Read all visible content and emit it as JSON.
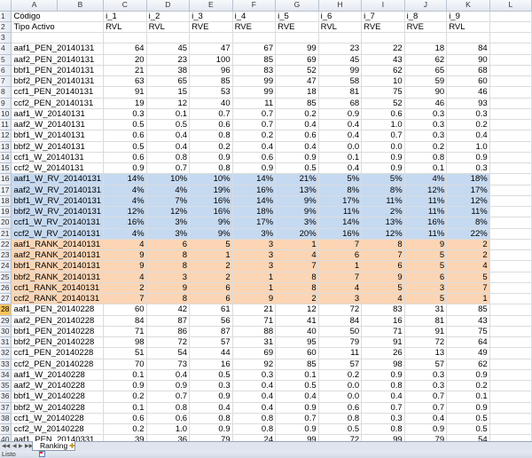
{
  "columns": [
    "A",
    "B",
    "C",
    "D",
    "E",
    "F",
    "G",
    "H",
    "I",
    "J",
    "K",
    "L"
  ],
  "active_row": 28,
  "colors": {
    "blue_fill": "#c5d9f1",
    "orange_fill": "#fcd5b4",
    "active_header": "#f7c35b"
  },
  "rows": [
    {
      "n": 1,
      "label": "Código",
      "vals": [
        "i_1",
        "i_2",
        "i_3",
        "i_4",
        "i_5",
        "i_6",
        "i_7",
        "i_8",
        "i_9"
      ],
      "text": true
    },
    {
      "n": 2,
      "label": "Tipo Activo",
      "vals": [
        "RVL",
        "RVL",
        "RVE",
        "RVE",
        "RVE",
        "RVL",
        "RVE",
        "RVE",
        "RVL"
      ],
      "text": true
    },
    {
      "n": 3,
      "label": "",
      "vals": [
        "",
        "",
        "",
        "",
        "",
        "",
        "",
        "",
        ""
      ]
    },
    {
      "n": 4,
      "label": "aaf1_PEN_20140131",
      "vals": [
        "64",
        "45",
        "47",
        "67",
        "99",
        "23",
        "22",
        "18",
        "84"
      ]
    },
    {
      "n": 5,
      "label": "aaf2_PEN_20140131",
      "vals": [
        "20",
        "23",
        "100",
        "85",
        "69",
        "45",
        "43",
        "62",
        "90"
      ]
    },
    {
      "n": 6,
      "label": "bbf1_PEN_20140131",
      "vals": [
        "21",
        "38",
        "96",
        "83",
        "52",
        "99",
        "62",
        "65",
        "68"
      ]
    },
    {
      "n": 7,
      "label": "bbf2_PEN_20140131",
      "vals": [
        "63",
        "65",
        "85",
        "99",
        "47",
        "58",
        "10",
        "59",
        "60"
      ]
    },
    {
      "n": 8,
      "label": "ccf1_PEN_20140131",
      "vals": [
        "91",
        "15",
        "53",
        "99",
        "18",
        "81",
        "75",
        "90",
        "46"
      ]
    },
    {
      "n": 9,
      "label": "ccf2_PEN_20140131",
      "vals": [
        "19",
        "12",
        "40",
        "11",
        "85",
        "68",
        "52",
        "46",
        "93"
      ]
    },
    {
      "n": 10,
      "label": "aaf1_W_20140131",
      "vals": [
        "0.3",
        "0.1",
        "0.7",
        "0.7",
        "0.2",
        "0.9",
        "0.6",
        "0.3",
        "0.3"
      ]
    },
    {
      "n": 11,
      "label": "aaf2_W_20140131",
      "vals": [
        "0.5",
        "0.5",
        "0.6",
        "0.7",
        "0.4",
        "0.4",
        "1.0",
        "0.3",
        "0.2"
      ]
    },
    {
      "n": 12,
      "label": "bbf1_W_20140131",
      "vals": [
        "0.6",
        "0.4",
        "0.8",
        "0.2",
        "0.6",
        "0.4",
        "0.7",
        "0.3",
        "0.4"
      ]
    },
    {
      "n": 13,
      "label": "bbf2_W_20140131",
      "vals": [
        "0.5",
        "0.4",
        "0.2",
        "0.4",
        "0.4",
        "0.0",
        "0.0",
        "0.2",
        "1.0"
      ]
    },
    {
      "n": 14,
      "label": "ccf1_W_20140131",
      "vals": [
        "0.6",
        "0.8",
        "0.9",
        "0.6",
        "0.9",
        "0.1",
        "0.9",
        "0.8",
        "0.9"
      ]
    },
    {
      "n": 15,
      "label": "ccf2_W_20140131",
      "vals": [
        "0.9",
        "0.7",
        "0.8",
        "0.9",
        "0.5",
        "0.4",
        "0.9",
        "0.1",
        "0.3"
      ]
    },
    {
      "n": 16,
      "label": "aaf1_W_RV_20140131",
      "vals": [
        "14%",
        "10%",
        "10%",
        "14%",
        "21%",
        "5%",
        "5%",
        "4%",
        "18%"
      ],
      "fill": "blue"
    },
    {
      "n": 17,
      "label": "aaf2_W_RV_20140131",
      "vals": [
        "4%",
        "4%",
        "19%",
        "16%",
        "13%",
        "8%",
        "8%",
        "12%",
        "17%"
      ],
      "fill": "blue"
    },
    {
      "n": 18,
      "label": "bbf1_W_RV_20140131",
      "vals": [
        "4%",
        "7%",
        "16%",
        "14%",
        "9%",
        "17%",
        "11%",
        "11%",
        "12%"
      ],
      "fill": "blue"
    },
    {
      "n": 19,
      "label": "bbf2_W_RV_20140131",
      "vals": [
        "12%",
        "12%",
        "16%",
        "18%",
        "9%",
        "11%",
        "2%",
        "11%",
        "11%"
      ],
      "fill": "blue"
    },
    {
      "n": 20,
      "label": "ccf1_W_RV_20140131",
      "vals": [
        "16%",
        "3%",
        "9%",
        "17%",
        "3%",
        "14%",
        "13%",
        "16%",
        "8%"
      ],
      "fill": "blue"
    },
    {
      "n": 21,
      "label": "ccf2_W_RV_20140131",
      "vals": [
        "4%",
        "3%",
        "9%",
        "3%",
        "20%",
        "16%",
        "12%",
        "11%",
        "22%"
      ],
      "fill": "blue"
    },
    {
      "n": 22,
      "label": "aaf1_RANK_20140131",
      "vals": [
        "4",
        "6",
        "5",
        "3",
        "1",
        "7",
        "8",
        "9",
        "2"
      ],
      "fill": "orange"
    },
    {
      "n": 23,
      "label": "aaf2_RANK_20140131",
      "vals": [
        "9",
        "8",
        "1",
        "3",
        "4",
        "6",
        "7",
        "5",
        "2"
      ],
      "fill": "orange"
    },
    {
      "n": 24,
      "label": "bbf1_RANK_20140131",
      "vals": [
        "9",
        "8",
        "2",
        "3",
        "7",
        "1",
        "6",
        "5",
        "4"
      ],
      "fill": "orange"
    },
    {
      "n": 25,
      "label": "bbf2_RANK_20140131",
      "vals": [
        "4",
        "3",
        "2",
        "1",
        "8",
        "7",
        "9",
        "6",
        "5"
      ],
      "fill": "orange"
    },
    {
      "n": 26,
      "label": "ccf1_RANK_20140131",
      "vals": [
        "2",
        "9",
        "6",
        "1",
        "8",
        "4",
        "5",
        "3",
        "7"
      ],
      "fill": "orange"
    },
    {
      "n": 27,
      "label": "ccf2_RANK_20140131",
      "vals": [
        "7",
        "8",
        "6",
        "9",
        "2",
        "3",
        "4",
        "5",
        "1"
      ],
      "fill": "orange"
    },
    {
      "n": 28,
      "label": "aaf1_PEN_20140228",
      "vals": [
        "60",
        "42",
        "61",
        "21",
        "12",
        "72",
        "83",
        "31",
        "85"
      ]
    },
    {
      "n": 29,
      "label": "aaf2_PEN_20140228",
      "vals": [
        "84",
        "87",
        "56",
        "71",
        "41",
        "84",
        "16",
        "81",
        "43"
      ]
    },
    {
      "n": 30,
      "label": "bbf1_PEN_20140228",
      "vals": [
        "71",
        "86",
        "87",
        "88",
        "40",
        "50",
        "71",
        "91",
        "75"
      ]
    },
    {
      "n": 31,
      "label": "bbf2_PEN_20140228",
      "vals": [
        "98",
        "72",
        "57",
        "31",
        "95",
        "79",
        "91",
        "72",
        "64"
      ]
    },
    {
      "n": 32,
      "label": "ccf1_PEN_20140228",
      "vals": [
        "51",
        "54",
        "44",
        "69",
        "60",
        "11",
        "26",
        "13",
        "49"
      ]
    },
    {
      "n": 33,
      "label": "ccf2_PEN_20140228",
      "vals": [
        "70",
        "73",
        "16",
        "92",
        "85",
        "57",
        "98",
        "57",
        "62"
      ]
    },
    {
      "n": 34,
      "label": "aaf1_W_20140228",
      "vals": [
        "0.1",
        "0.4",
        "0.5",
        "0.3",
        "0.1",
        "0.2",
        "0.9",
        "0.3",
        "0.9"
      ]
    },
    {
      "n": 35,
      "label": "aaf2_W_20140228",
      "vals": [
        "0.9",
        "0.9",
        "0.3",
        "0.4",
        "0.5",
        "0.0",
        "0.8",
        "0.3",
        "0.2"
      ]
    },
    {
      "n": 36,
      "label": "bbf1_W_20140228",
      "vals": [
        "0.2",
        "0.7",
        "0.9",
        "0.4",
        "0.4",
        "0.0",
        "0.4",
        "0.7",
        "0.1"
      ]
    },
    {
      "n": 37,
      "label": "bbf2_W_20140228",
      "vals": [
        "0.1",
        "0.8",
        "0.4",
        "0.4",
        "0.9",
        "0.6",
        "0.7",
        "0.7",
        "0.9"
      ]
    },
    {
      "n": 38,
      "label": "ccf1_W_20140228",
      "vals": [
        "0.6",
        "0.6",
        "0.8",
        "0.8",
        "0.7",
        "0.8",
        "0.3",
        "0.4",
        "0.5"
      ]
    },
    {
      "n": 39,
      "label": "ccf2_W_20140228",
      "vals": [
        "0.2",
        "1.0",
        "0.9",
        "0.8",
        "0.9",
        "0.5",
        "0.8",
        "0.9",
        "0.5"
      ]
    },
    {
      "n": 40,
      "label": "aaf1_PEN_20140331",
      "vals": [
        "39",
        "36",
        "79",
        "24",
        "99",
        "72",
        "99",
        "79",
        "54"
      ]
    }
  ],
  "sheet_tab": "Ranking",
  "status": "Listo"
}
